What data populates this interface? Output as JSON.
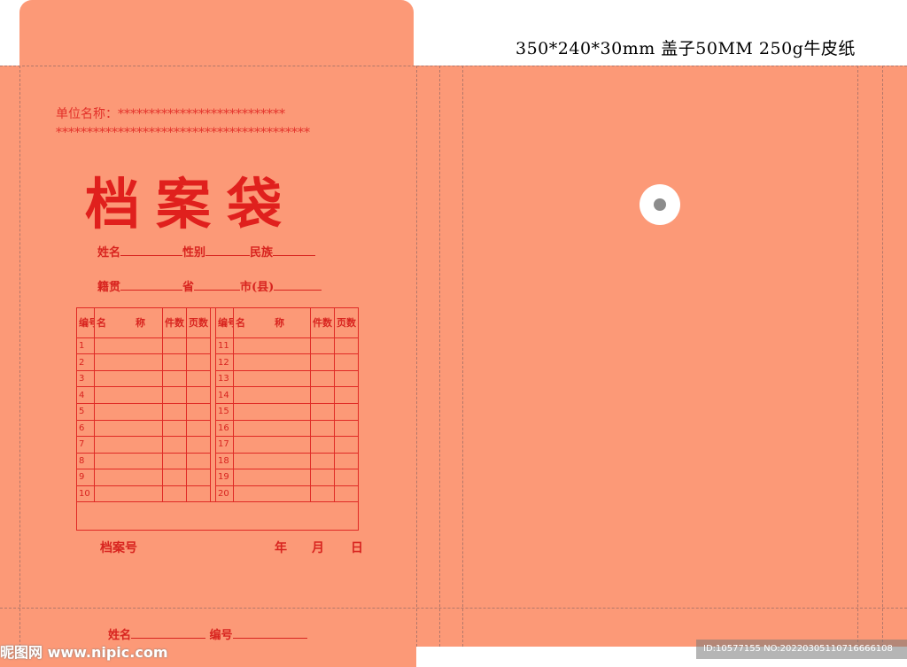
{
  "spec_text": "350*240*30mm  盖子50MM 250g牛皮纸",
  "unit_line1": "单位名称：***************************",
  "unit_line2": "*****************************************",
  "title": "档案袋",
  "row1": {
    "name": "姓名",
    "gender": "性别",
    "ethnicity": "民族"
  },
  "row2": {
    "native": "籍贯",
    "province": "省",
    "city": "市(县)"
  },
  "table": {
    "headers": [
      "编号",
      "名　　　称",
      "件数",
      "页数"
    ],
    "left_numbers": [
      "1",
      "2",
      "3",
      "4",
      "5",
      "6",
      "7",
      "8",
      "9",
      "10"
    ],
    "right_numbers": [
      "11",
      "12",
      "13",
      "14",
      "15",
      "16",
      "17",
      "18",
      "19",
      "20"
    ]
  },
  "archive_no": "档案号",
  "date": {
    "year": "年",
    "month": "月",
    "day": "日"
  },
  "bottom": {
    "name": "姓名",
    "number": "编号"
  },
  "watermark": "昵图网 www.nipic.com",
  "image_id": "ID:10577155 NO:20220305110716666108",
  "colors": {
    "kraft": "#fc9977",
    "print_red": "#e0201d"
  }
}
